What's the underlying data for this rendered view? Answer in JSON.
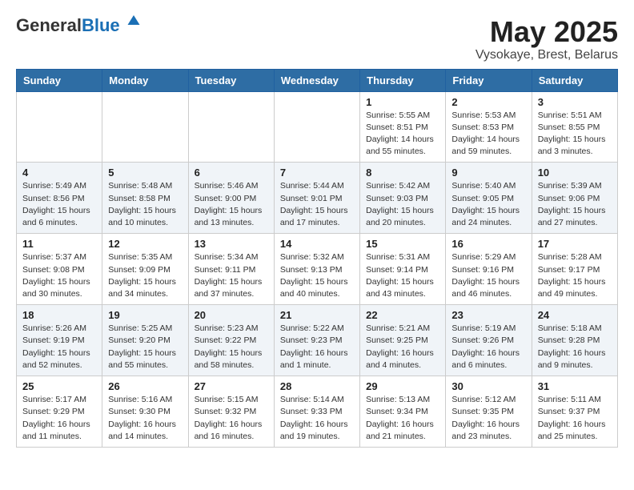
{
  "logo": {
    "general": "General",
    "blue": "Blue"
  },
  "header": {
    "month_year": "May 2025",
    "location": "Vysokaye, Brest, Belarus"
  },
  "weekdays": [
    "Sunday",
    "Monday",
    "Tuesday",
    "Wednesday",
    "Thursday",
    "Friday",
    "Saturday"
  ],
  "weeks": [
    [
      {
        "day": "",
        "info": ""
      },
      {
        "day": "",
        "info": ""
      },
      {
        "day": "",
        "info": ""
      },
      {
        "day": "",
        "info": ""
      },
      {
        "day": "1",
        "info": "Sunrise: 5:55 AM\nSunset: 8:51 PM\nDaylight: 14 hours\nand 55 minutes."
      },
      {
        "day": "2",
        "info": "Sunrise: 5:53 AM\nSunset: 8:53 PM\nDaylight: 14 hours\nand 59 minutes."
      },
      {
        "day": "3",
        "info": "Sunrise: 5:51 AM\nSunset: 8:55 PM\nDaylight: 15 hours\nand 3 minutes."
      }
    ],
    [
      {
        "day": "4",
        "info": "Sunrise: 5:49 AM\nSunset: 8:56 PM\nDaylight: 15 hours\nand 6 minutes."
      },
      {
        "day": "5",
        "info": "Sunrise: 5:48 AM\nSunset: 8:58 PM\nDaylight: 15 hours\nand 10 minutes."
      },
      {
        "day": "6",
        "info": "Sunrise: 5:46 AM\nSunset: 9:00 PM\nDaylight: 15 hours\nand 13 minutes."
      },
      {
        "day": "7",
        "info": "Sunrise: 5:44 AM\nSunset: 9:01 PM\nDaylight: 15 hours\nand 17 minutes."
      },
      {
        "day": "8",
        "info": "Sunrise: 5:42 AM\nSunset: 9:03 PM\nDaylight: 15 hours\nand 20 minutes."
      },
      {
        "day": "9",
        "info": "Sunrise: 5:40 AM\nSunset: 9:05 PM\nDaylight: 15 hours\nand 24 minutes."
      },
      {
        "day": "10",
        "info": "Sunrise: 5:39 AM\nSunset: 9:06 PM\nDaylight: 15 hours\nand 27 minutes."
      }
    ],
    [
      {
        "day": "11",
        "info": "Sunrise: 5:37 AM\nSunset: 9:08 PM\nDaylight: 15 hours\nand 30 minutes."
      },
      {
        "day": "12",
        "info": "Sunrise: 5:35 AM\nSunset: 9:09 PM\nDaylight: 15 hours\nand 34 minutes."
      },
      {
        "day": "13",
        "info": "Sunrise: 5:34 AM\nSunset: 9:11 PM\nDaylight: 15 hours\nand 37 minutes."
      },
      {
        "day": "14",
        "info": "Sunrise: 5:32 AM\nSunset: 9:13 PM\nDaylight: 15 hours\nand 40 minutes."
      },
      {
        "day": "15",
        "info": "Sunrise: 5:31 AM\nSunset: 9:14 PM\nDaylight: 15 hours\nand 43 minutes."
      },
      {
        "day": "16",
        "info": "Sunrise: 5:29 AM\nSunset: 9:16 PM\nDaylight: 15 hours\nand 46 minutes."
      },
      {
        "day": "17",
        "info": "Sunrise: 5:28 AM\nSunset: 9:17 PM\nDaylight: 15 hours\nand 49 minutes."
      }
    ],
    [
      {
        "day": "18",
        "info": "Sunrise: 5:26 AM\nSunset: 9:19 PM\nDaylight: 15 hours\nand 52 minutes."
      },
      {
        "day": "19",
        "info": "Sunrise: 5:25 AM\nSunset: 9:20 PM\nDaylight: 15 hours\nand 55 minutes."
      },
      {
        "day": "20",
        "info": "Sunrise: 5:23 AM\nSunset: 9:22 PM\nDaylight: 15 hours\nand 58 minutes."
      },
      {
        "day": "21",
        "info": "Sunrise: 5:22 AM\nSunset: 9:23 PM\nDaylight: 16 hours\nand 1 minute."
      },
      {
        "day": "22",
        "info": "Sunrise: 5:21 AM\nSunset: 9:25 PM\nDaylight: 16 hours\nand 4 minutes."
      },
      {
        "day": "23",
        "info": "Sunrise: 5:19 AM\nSunset: 9:26 PM\nDaylight: 16 hours\nand 6 minutes."
      },
      {
        "day": "24",
        "info": "Sunrise: 5:18 AM\nSunset: 9:28 PM\nDaylight: 16 hours\nand 9 minutes."
      }
    ],
    [
      {
        "day": "25",
        "info": "Sunrise: 5:17 AM\nSunset: 9:29 PM\nDaylight: 16 hours\nand 11 minutes."
      },
      {
        "day": "26",
        "info": "Sunrise: 5:16 AM\nSunset: 9:30 PM\nDaylight: 16 hours\nand 14 minutes."
      },
      {
        "day": "27",
        "info": "Sunrise: 5:15 AM\nSunset: 9:32 PM\nDaylight: 16 hours\nand 16 minutes."
      },
      {
        "day": "28",
        "info": "Sunrise: 5:14 AM\nSunset: 9:33 PM\nDaylight: 16 hours\nand 19 minutes."
      },
      {
        "day": "29",
        "info": "Sunrise: 5:13 AM\nSunset: 9:34 PM\nDaylight: 16 hours\nand 21 minutes."
      },
      {
        "day": "30",
        "info": "Sunrise: 5:12 AM\nSunset: 9:35 PM\nDaylight: 16 hours\nand 23 minutes."
      },
      {
        "day": "31",
        "info": "Sunrise: 5:11 AM\nSunset: 9:37 PM\nDaylight: 16 hours\nand 25 minutes."
      }
    ]
  ]
}
